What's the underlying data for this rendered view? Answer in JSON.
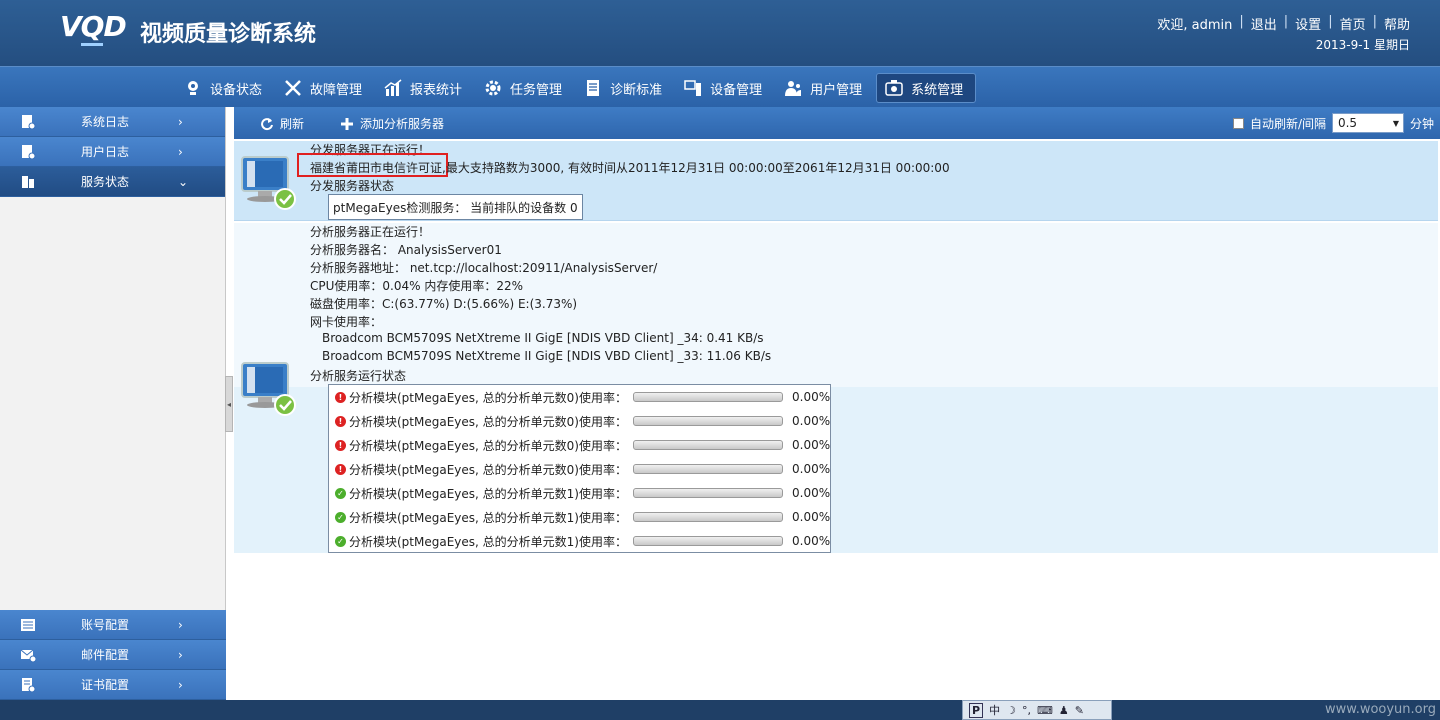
{
  "header": {
    "logo_prefix": "V",
    "logo_q": "Q",
    "logo_suffix": "D",
    "title": "视频质量诊断系统",
    "welcome": "欢迎, admin",
    "links": [
      "退出",
      "设置",
      "首页",
      "帮助"
    ],
    "date": "2013-9-1 星期日"
  },
  "nav": {
    "items": [
      {
        "label": "设备状态",
        "icon": "camera-icon"
      },
      {
        "label": "故障管理",
        "icon": "tools-icon"
      },
      {
        "label": "报表统计",
        "icon": "chart-icon"
      },
      {
        "label": "任务管理",
        "icon": "gear-icon"
      },
      {
        "label": "诊断标准",
        "icon": "document-icon"
      },
      {
        "label": "设备管理",
        "icon": "device-icon"
      },
      {
        "label": "用户管理",
        "icon": "users-icon"
      },
      {
        "label": "系统管理",
        "icon": "system-icon"
      }
    ],
    "active_index": 7
  },
  "sidebar": {
    "items": [
      {
        "label": "系统日志",
        "arrow": "›"
      },
      {
        "label": "用户日志",
        "arrow": "›"
      },
      {
        "label": "服务状态",
        "arrow": "⌄"
      }
    ],
    "bottom_items": [
      {
        "label": "账号配置",
        "arrow": "›"
      },
      {
        "label": "邮件配置",
        "arrow": "›"
      },
      {
        "label": "证书配置",
        "arrow": "›"
      }
    ]
  },
  "toolbar": {
    "refresh_label": "刷新",
    "add_label": "添加分析服务器",
    "auto_refresh_label": "自动刷新/间隔",
    "interval_value": "0.5",
    "unit_label": "分钟"
  },
  "dispatch": {
    "running": "分发服务器正在运行！",
    "license_highlight": "福建省莆田市电信许可证",
    "license_rest": ",最大支持路数为3000, 有效时间从2011年12月31日 00:00:00至2061年12月31日 00:00:00",
    "status_title": "分发服务器状态",
    "service_text": "ptMegaEyes检测服务：  当前排队的设备数  0"
  },
  "analysis": {
    "running": "分析服务器正在运行！",
    "name": "分析服务器名：  AnalysisServer01",
    "address": "分析服务器地址：  net.tcp://localhost:20911/AnalysisServer/",
    "cpu_mem": "CPU使用率：0.04%  内存使用率：22%",
    "disk": "磁盘使用率：C:(63.77%)  D:(5.66%)  E:(3.73%)",
    "nic_title": "网卡使用率：",
    "nics": [
      "Broadcom BCM5709S NetXtreme II GigE [NDIS VBD Client] _34: 0.41 KB/s",
      "Broadcom BCM5709S NetXtreme II GigE [NDIS VBD Client] _33: 11.06 KB/s"
    ],
    "run_status_title": "分析服务运行状态",
    "modules": [
      {
        "label": "分析模块(ptMegaEyes, 总的分析单元数0)使用率：",
        "status": "error",
        "percent": "0.00%",
        "fill": 0
      },
      {
        "label": "分析模块(ptMegaEyes, 总的分析单元数0)使用率：",
        "status": "error",
        "percent": "0.00%",
        "fill": 0
      },
      {
        "label": "分析模块(ptMegaEyes, 总的分析单元数0)使用率：",
        "status": "error",
        "percent": "0.00%",
        "fill": 0
      },
      {
        "label": "分析模块(ptMegaEyes, 总的分析单元数0)使用率：",
        "status": "error",
        "percent": "0.00%",
        "fill": 0
      },
      {
        "label": "分析模块(ptMegaEyes, 总的分析单元数1)使用率：",
        "status": "ok",
        "percent": "0.00%",
        "fill": 0
      },
      {
        "label": "分析模块(ptMegaEyes, 总的分析单元数1)使用率：",
        "status": "ok",
        "percent": "0.00%",
        "fill": 0
      },
      {
        "label": "分析模块(ptMegaEyes, 总的分析单元数1)使用率：",
        "status": "ok",
        "percent": "0.00%",
        "fill": 0
      }
    ]
  },
  "ime": {
    "text": "中"
  },
  "watermark": "www.wooyun.org",
  "colors": {
    "header": "#2e5f95",
    "nav": "#3a76bd",
    "highlight": "#e02020",
    "ok": "#4cae2c",
    "error": "#d22222"
  }
}
